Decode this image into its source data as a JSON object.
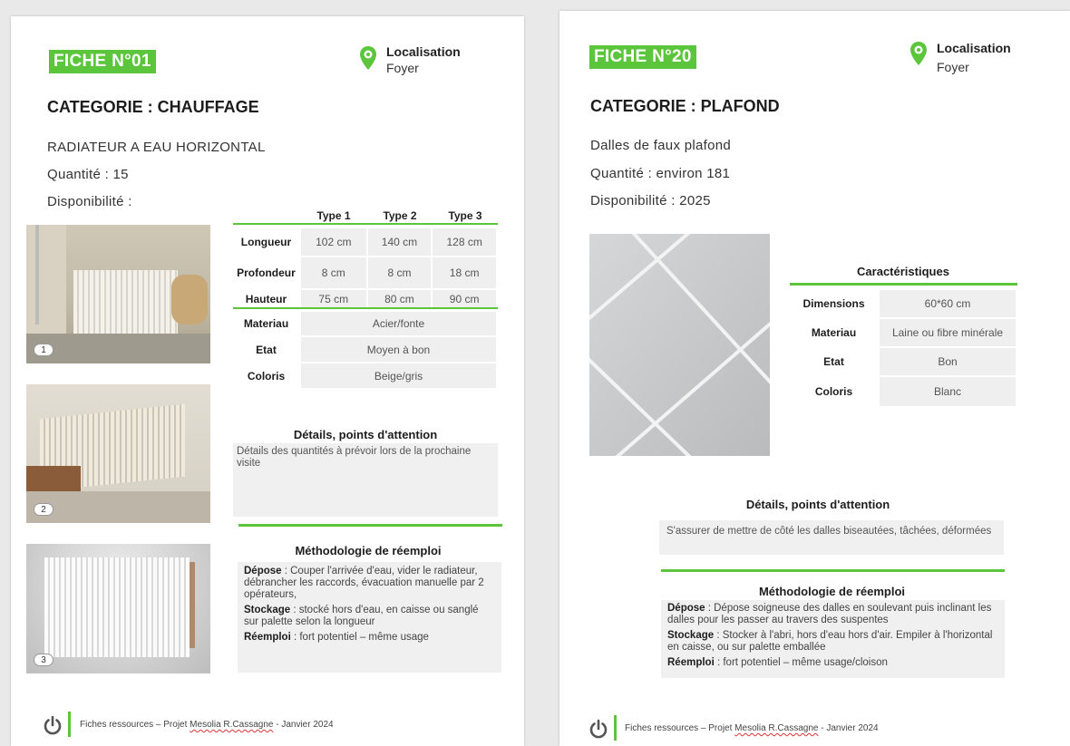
{
  "brand_color": "#5bc63c",
  "page1": {
    "fiche": "FICHE N°01",
    "location_label": "Localisation",
    "location_value": "Foyer",
    "category": "CATEGORIE : CHAUFFAGE",
    "item_name": "RADIATEUR A EAU HORIZONTAL",
    "quantity": "Quantité :  15",
    "availability": "Disponibilité :",
    "photo_numbers": [
      "1",
      "2",
      "3"
    ],
    "table": {
      "headers": [
        "Type 1",
        "Type 2",
        "Type 3"
      ],
      "rows": [
        {
          "label": "Longueur",
          "values": [
            "102 cm",
            "140 cm",
            "128 cm"
          ]
        },
        {
          "label": "Profondeur",
          "values": [
            "8 cm",
            "8 cm",
            "18 cm"
          ]
        },
        {
          "label": "Hauteur",
          "values": [
            "75 cm",
            "80 cm",
            "90 cm"
          ]
        }
      ],
      "merged_rows": [
        {
          "label": "Materiau",
          "value": "Acier/fonte"
        },
        {
          "label": "Etat",
          "value": "Moyen à bon"
        },
        {
          "label": "Coloris",
          "value": "Beige/gris"
        }
      ]
    },
    "details_title": "Détails, points d'attention",
    "details_text": "Détails des quantités à prévoir lors de la prochaine visite",
    "method_title": "Méthodologie de réemploi",
    "method": [
      {
        "label": "Dépose",
        "text": " : Couper l'arrivée d'eau, vider le radiateur, débrancher les raccords, évacuation manuelle par 2 opérateurs,"
      },
      {
        "label": "Stockage",
        "text": " : stocké hors d'eau, en caisse ou sanglé sur palette selon la longueur"
      },
      {
        "label": "Réemploi",
        "text": " : fort potentiel – même usage"
      }
    ],
    "footer_prefix": "Fiches ressources – Projet ",
    "footer_link": "Mesolia R.Cassagne",
    "footer_suffix": " - Janvier 2024"
  },
  "page2": {
    "fiche": "FICHE N°20",
    "location_label": "Localisation",
    "location_value": "Foyer",
    "category": "CATEGORIE : PLAFOND",
    "item_name": "Dalles de faux plafond",
    "quantity": "Quantité :  environ 181",
    "availability": "Disponibilité : 2025",
    "char_title": "Caractéristiques",
    "characteristics": [
      {
        "label": "Dimensions",
        "value": "60*60 cm"
      },
      {
        "label": "Materiau",
        "value": "Laine ou fibre minérale"
      },
      {
        "label": "Etat",
        "value": "Bon"
      },
      {
        "label": "Coloris",
        "value": "Blanc"
      }
    ],
    "details_title": "Détails, points d'attention",
    "details_text": "S'assurer de mettre de côté les dalles biseautées, tâchées, déformées",
    "method_title": "Méthodologie de réemploi",
    "method": [
      {
        "label": "Dépose",
        "text": " : Dépose soigneuse des dalles en soulevant puis inclinant les dalles pour les passer au travers des suspentes"
      },
      {
        "label": "Stockage",
        "text": " : Stocker à l'abri, hors d'eau hors d'air. Empiler à l'horizontal en caisse, ou sur palette emballée"
      },
      {
        "label": "Réemploi",
        "text": " : fort potentiel – même usage/cloison"
      }
    ],
    "footer_prefix": "Fiches ressources – Projet ",
    "footer_link": "Mesolia R.Cassagne",
    "footer_suffix": " - Janvier 2024"
  }
}
